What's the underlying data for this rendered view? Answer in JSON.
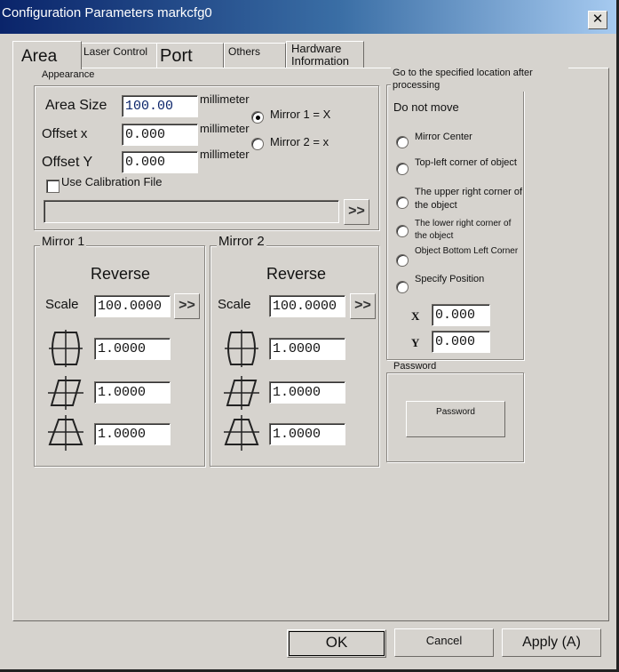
{
  "window": {
    "title": "Configuration Parameters markcfg0"
  },
  "tabs": [
    {
      "label": "Area",
      "active": true
    },
    {
      "label": "Laser Control"
    },
    {
      "label": "Port"
    },
    {
      "label": "Others"
    },
    {
      "label": "Hardware Information"
    }
  ],
  "appearance": {
    "title": "Appearance",
    "area_size_label": "Area Size",
    "area_size_value": "100.00",
    "offset_x_label": "Offset x",
    "offset_x_value": "0.000",
    "offset_y_label": "Offset Y",
    "offset_y_value": "0.000",
    "unit": "millimeter",
    "mirror1_radio": "Mirror 1 = X",
    "mirror2_radio": "Mirror 2 = x",
    "mirror1_checked": true,
    "calibration_label": "Use Calibration File",
    "calibration_checked": false,
    "calibration_path": "",
    "browse_glyph": ">>"
  },
  "mirror1": {
    "title": "Mirror 1",
    "reverse_label": "Reverse",
    "scale_label": "Scale",
    "scale_value": "100.0000",
    "arrow_glyph": ">>",
    "barrel_value": "1.0000",
    "parallelogram_value": "1.0000",
    "trapezoid_value": "1.0000"
  },
  "mirror2": {
    "title": "Mirror 2",
    "reverse_label": "Reverse",
    "scale_label": "Scale",
    "scale_value": "100.0000",
    "arrow_glyph": ">>",
    "barrel_value": "1.0000",
    "parallelogram_value": "1.0000",
    "trapezoid_value": "1.0000"
  },
  "goto": {
    "title": "Go to the specified location after processing",
    "do_not_move": "Do not move",
    "options": [
      "Mirror Center",
      "Top-left corner of object",
      "The upper right corner of the object",
      "The lower right corner of the object",
      "Object Bottom Left Corner",
      "Specify Position"
    ],
    "x_label": "X",
    "x_value": "0.000",
    "y_label": "Y",
    "y_value": "0.000"
  },
  "password": {
    "title": "Password",
    "button_label": "Password"
  },
  "footer": {
    "ok_label": "OK",
    "cancel_label": "Cancel",
    "apply_label": "Apply (A)"
  },
  "colors": {
    "face": "#d6d3ce",
    "titlebar_start": "#0a246a",
    "titlebar_end": "#a6caf0"
  }
}
